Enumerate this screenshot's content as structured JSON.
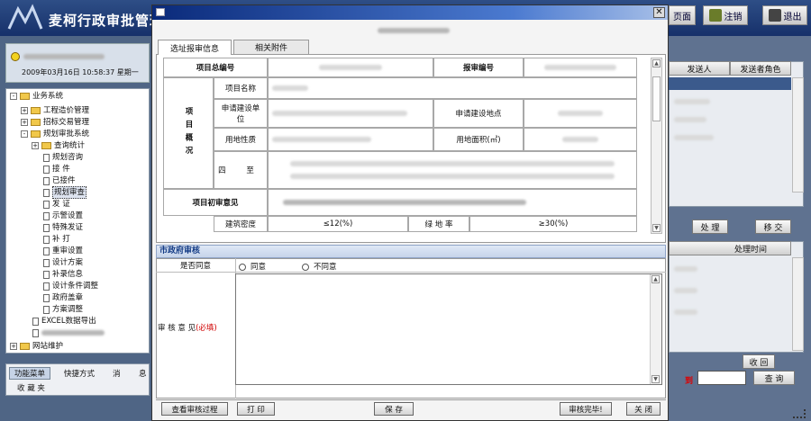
{
  "app": {
    "title": "麦柯行政审批管理",
    "header_buttons": [
      "页面",
      "注销",
      "退出"
    ]
  },
  "left": {
    "datetime": "2009年03月16日 10:58:37 星期一",
    "tree": [
      {
        "label": "业务系统",
        "type": "folder",
        "level": 0,
        "expand": "-"
      },
      {
        "label": "工程造价管理",
        "type": "folder",
        "level": 1,
        "expand": "+"
      },
      {
        "label": "招标交易管理",
        "type": "folder",
        "level": 1,
        "expand": "+"
      },
      {
        "label": "规划审批系统",
        "type": "folder",
        "level": 1,
        "expand": "-"
      },
      {
        "label": "查询统计",
        "type": "folder",
        "level": 2,
        "expand": "+"
      },
      {
        "label": "规划咨询",
        "type": "doc",
        "level": 2
      },
      {
        "label": "接 件",
        "type": "doc",
        "level": 2
      },
      {
        "label": "已接件",
        "type": "doc",
        "level": 2
      },
      {
        "label": "规划审查",
        "type": "doc",
        "level": 2,
        "selected": true
      },
      {
        "label": "发 证",
        "type": "doc",
        "level": 2
      },
      {
        "label": "示警设置",
        "type": "doc",
        "level": 2
      },
      {
        "label": "特殊发证",
        "type": "doc",
        "level": 2
      },
      {
        "label": "补 打",
        "type": "doc",
        "level": 2
      },
      {
        "label": "重审设置",
        "type": "doc",
        "level": 2
      },
      {
        "label": "设计方案",
        "type": "doc",
        "level": 2
      },
      {
        "label": "补录信息",
        "type": "doc",
        "level": 2
      },
      {
        "label": "设计条件调整",
        "type": "doc",
        "level": 2
      },
      {
        "label": "政府盖章",
        "type": "doc",
        "level": 2
      },
      {
        "label": "方案调整",
        "type": "doc",
        "level": 2
      },
      {
        "label": "EXCEL数据导出",
        "type": "doc",
        "level": 1
      },
      {
        "label": "",
        "type": "doc",
        "level": 1
      },
      {
        "label": "网站维护",
        "type": "folder",
        "level": 0,
        "expand": "+"
      }
    ],
    "bottom_tabs": [
      "功能菜单",
      "快捷方式",
      "消",
      "息"
    ],
    "bottom_tab2": "收 藏 夹"
  },
  "right": {
    "top_cols": [
      "发送人",
      "发送者角色"
    ],
    "top_buttons": [
      "处 理",
      "移 交"
    ],
    "bottom_col": "处理时间",
    "recv_button": "收 回",
    "query_button": "查 询",
    "to_label": "到"
  },
  "dialog": {
    "tabs": [
      "选址报审信息",
      "相关附件"
    ],
    "table": {
      "project_no": "项目总编号",
      "report_no": "报审编号",
      "overview": "项目概况",
      "name": "项目名称",
      "applicant": "申请建设单    位",
      "location": "申请建设地点",
      "land_nature": "用地性质",
      "land_area": "用地面积(㎡)",
      "boundary": "四 至",
      "preliminary": "项目初审意见",
      "density": "建筑密度",
      "density_val": "≤12(%)",
      "green_rate": "绿 地 率",
      "green_val": "≥30(%)"
    },
    "review": {
      "section": "市政府审核",
      "agree_label": "是否同意",
      "agree": "同意",
      "disagree": "不同意",
      "opinion_label": "审 核 意 见",
      "required": "(必填)"
    },
    "buttons": [
      "查看审核过程",
      "打 印",
      "保 存",
      "审核完毕!",
      "关 闭"
    ]
  },
  "colors": {
    "header": "#1d3a78",
    "dialog_title": "#0a2a7a",
    "required": "#d00000"
  }
}
